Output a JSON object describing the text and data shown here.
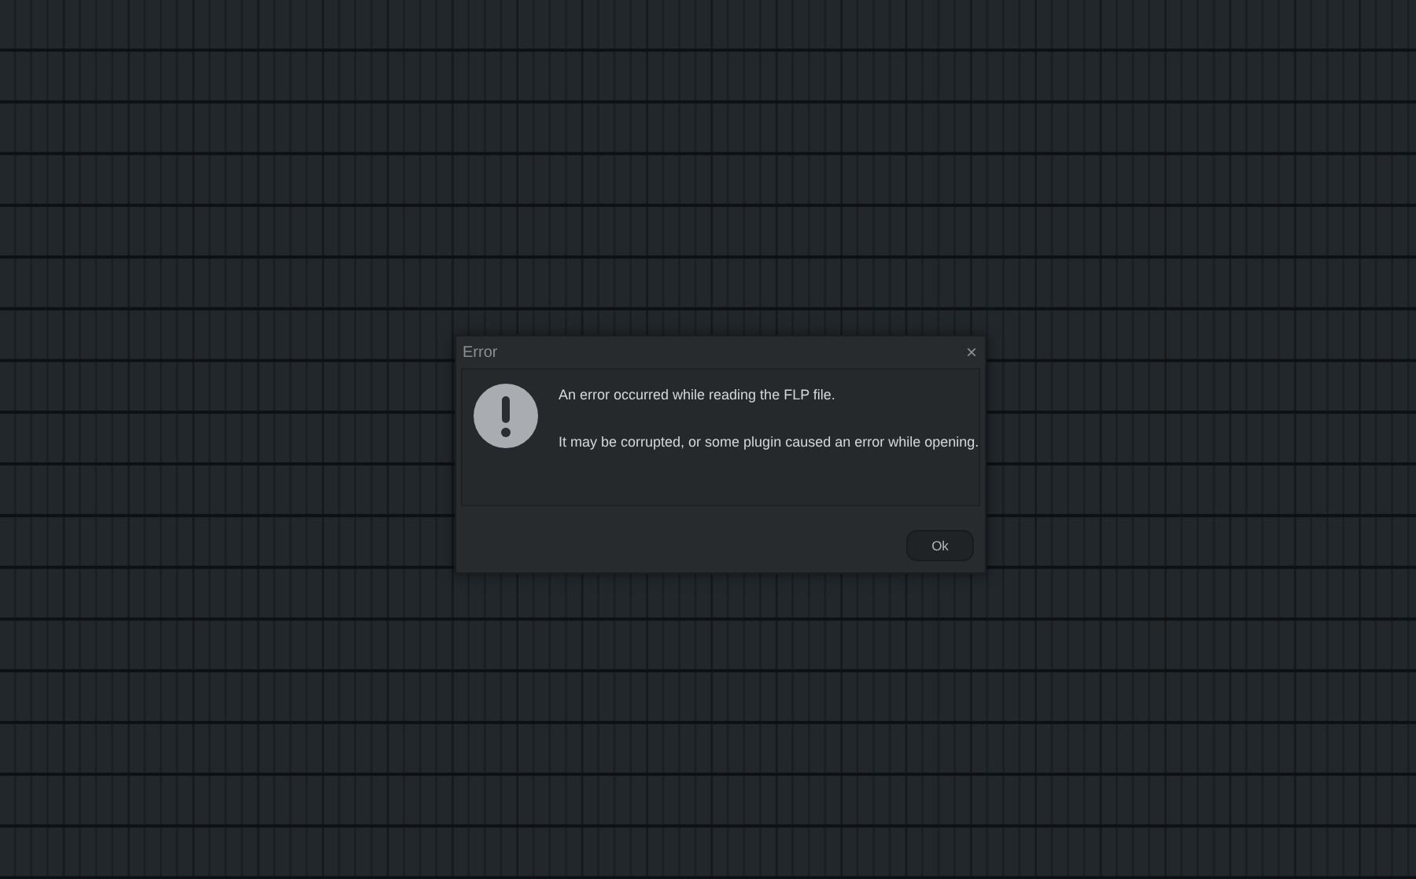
{
  "dialog": {
    "title": "Error",
    "close": "×",
    "messages": [
      "An error occurred while reading the FLP file.",
      "It may be corrupted, or some plugin caused an error while opening."
    ],
    "buttons": [
      "Ok"
    ]
  }
}
